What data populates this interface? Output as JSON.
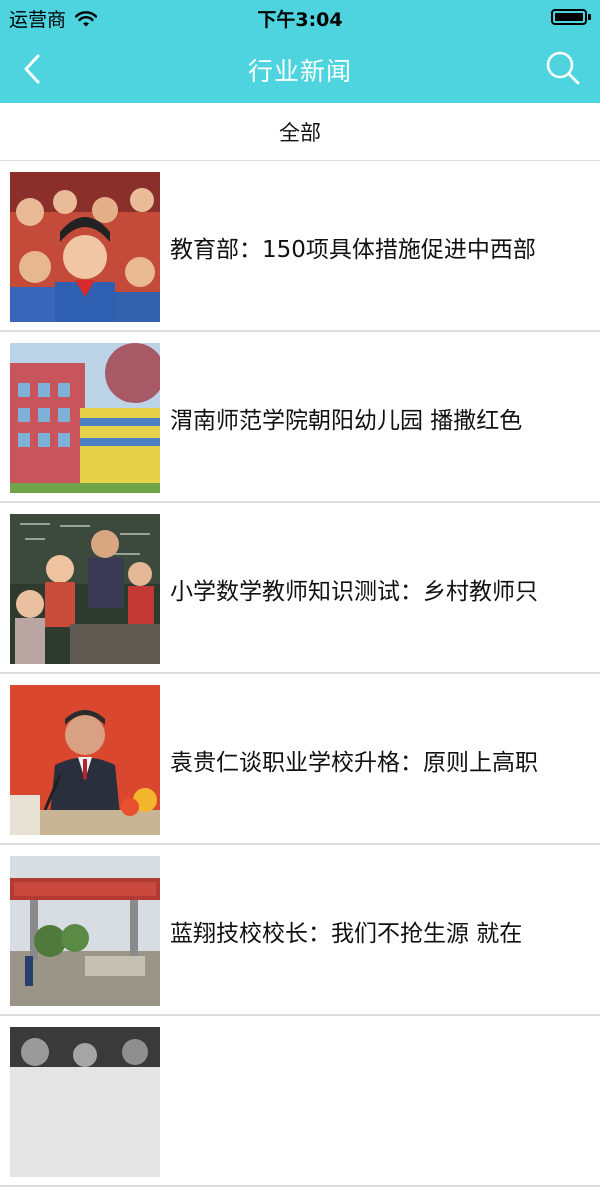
{
  "status_bar": {
    "carrier": "运营商",
    "time": "下午3:04"
  },
  "nav": {
    "title": "行业新闻"
  },
  "category": {
    "label": "全部"
  },
  "news": [
    {
      "title": "教育部：150项具体措施促进中西部"
    },
    {
      "title": "渭南师范学院朝阳幼儿园 播撒红色"
    },
    {
      "title": "小学数学教师知识测试：乡村教师只"
    },
    {
      "title": "袁贵仁谈职业学校升格：原则上高职"
    },
    {
      "title": "蓝翔技校校长：我们不抢生源 就在"
    },
    {
      "title": ""
    }
  ],
  "colors": {
    "header": "#4dd4df",
    "divider": "#dddddd"
  }
}
